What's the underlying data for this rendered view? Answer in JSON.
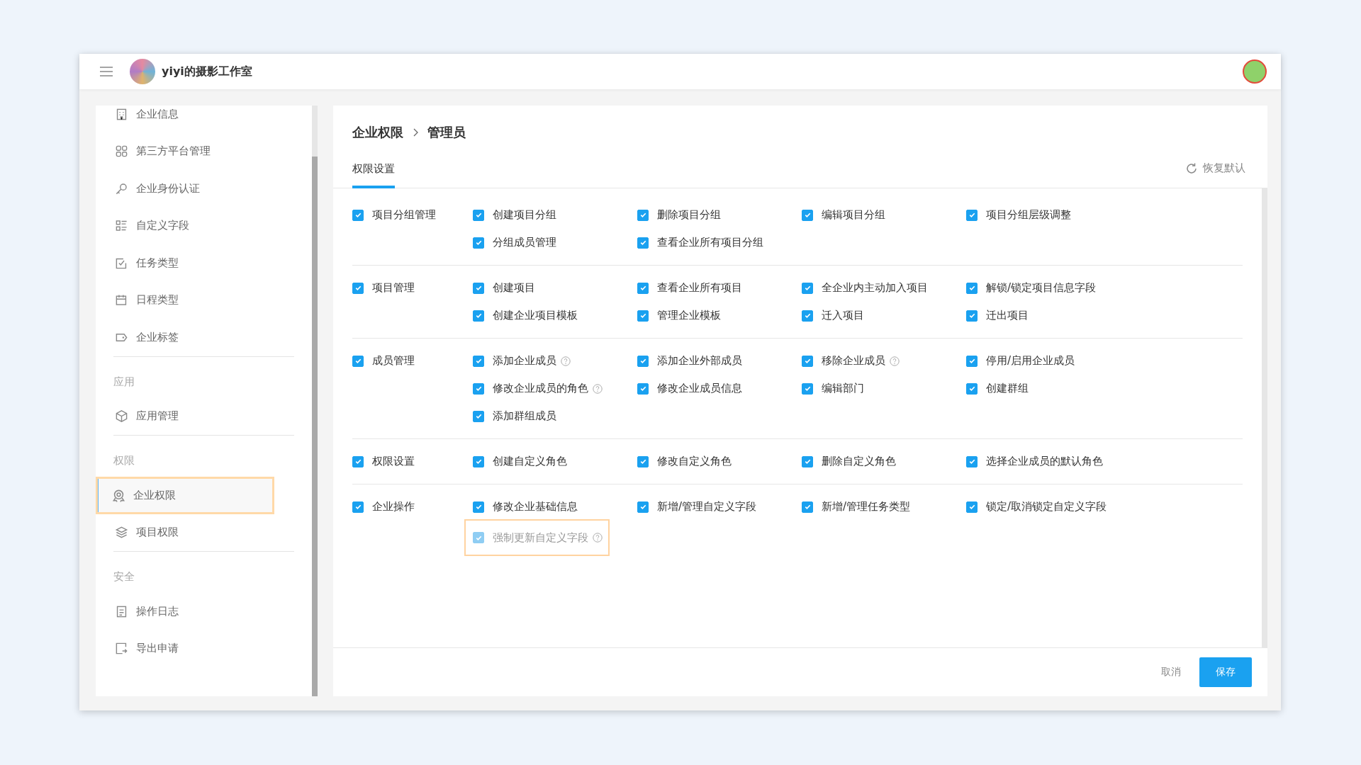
{
  "header": {
    "title": "yiyi的摄影工作室"
  },
  "sidebar": {
    "groups": [
      {
        "items": [
          {
            "label": "企业信息",
            "selected": false,
            "highlighted": false
          },
          {
            "label": "第三方平台管理",
            "selected": false,
            "highlighted": false
          },
          {
            "label": "企业身份认证",
            "selected": false,
            "highlighted": false
          },
          {
            "label": "自定义字段",
            "selected": false,
            "highlighted": false
          },
          {
            "label": "任务类型",
            "selected": false,
            "highlighted": false
          },
          {
            "label": "日程类型",
            "selected": false,
            "highlighted": false
          },
          {
            "label": "企业标签",
            "selected": false,
            "highlighted": false
          }
        ]
      },
      {
        "title": "应用",
        "items": [
          {
            "label": "应用管理",
            "selected": false,
            "highlighted": false
          }
        ]
      },
      {
        "title": "权限",
        "items": [
          {
            "label": "企业权限",
            "selected": true,
            "highlighted": true
          },
          {
            "label": "项目权限",
            "selected": false,
            "highlighted": false
          }
        ]
      },
      {
        "title": "安全",
        "items": [
          {
            "label": "操作日志",
            "selected": false,
            "highlighted": false
          },
          {
            "label": "导出申请",
            "selected": false,
            "highlighted": false
          }
        ]
      }
    ]
  },
  "breadcrumb": [
    "企业权限",
    "管理员"
  ],
  "tabs": [
    {
      "label": "权限设置",
      "selected": true
    }
  ],
  "reset_button": "恢复默认",
  "permission_groups": [
    {
      "parent": {
        "label": "项目分组管理",
        "checked": true
      },
      "children": [
        {
          "label": "创建项目分组",
          "checked": true,
          "help": false,
          "disabled": false,
          "highlighted": false
        },
        {
          "label": "删除项目分组",
          "checked": true,
          "help": false,
          "disabled": false,
          "highlighted": false
        },
        {
          "label": "编辑项目分组",
          "checked": true,
          "help": false,
          "disabled": false,
          "highlighted": false
        },
        {
          "label": "项目分组层级调整",
          "checked": true,
          "help": false,
          "disabled": false,
          "highlighted": false
        },
        {
          "label": "分组成员管理",
          "checked": true,
          "help": false,
          "disabled": false,
          "highlighted": false
        },
        {
          "label": "查看企业所有项目分组",
          "checked": true,
          "help": false,
          "disabled": false,
          "highlighted": false
        }
      ]
    },
    {
      "parent": {
        "label": "项目管理",
        "checked": true
      },
      "children": [
        {
          "label": "创建项目",
          "checked": true,
          "help": false,
          "disabled": false,
          "highlighted": false
        },
        {
          "label": "查看企业所有项目",
          "checked": true,
          "help": false,
          "disabled": false,
          "highlighted": false
        },
        {
          "label": "全企业内主动加入项目",
          "checked": true,
          "help": false,
          "disabled": false,
          "highlighted": false
        },
        {
          "label": "解锁/锁定项目信息字段",
          "checked": true,
          "help": false,
          "disabled": false,
          "highlighted": false
        },
        {
          "label": "创建企业项目模板",
          "checked": true,
          "help": false,
          "disabled": false,
          "highlighted": false
        },
        {
          "label": "管理企业模板",
          "checked": true,
          "help": false,
          "disabled": false,
          "highlighted": false
        },
        {
          "label": "迁入项目",
          "checked": true,
          "help": false,
          "disabled": false,
          "highlighted": false
        },
        {
          "label": "迁出项目",
          "checked": true,
          "help": false,
          "disabled": false,
          "highlighted": false
        }
      ]
    },
    {
      "parent": {
        "label": "成员管理",
        "checked": true
      },
      "children": [
        {
          "label": "添加企业成员",
          "checked": true,
          "help": true,
          "disabled": false,
          "highlighted": false
        },
        {
          "label": "添加企业外部成员",
          "checked": true,
          "help": false,
          "disabled": false,
          "highlighted": false
        },
        {
          "label": "移除企业成员",
          "checked": true,
          "help": true,
          "disabled": false,
          "highlighted": false
        },
        {
          "label": "停用/启用企业成员",
          "checked": true,
          "help": false,
          "disabled": false,
          "highlighted": false
        },
        {
          "label": "修改企业成员的角色",
          "checked": true,
          "help": true,
          "disabled": false,
          "highlighted": false
        },
        {
          "label": "修改企业成员信息",
          "checked": true,
          "help": false,
          "disabled": false,
          "highlighted": false
        },
        {
          "label": "编辑部门",
          "checked": true,
          "help": false,
          "disabled": false,
          "highlighted": false
        },
        {
          "label": "创建群组",
          "checked": true,
          "help": false,
          "disabled": false,
          "highlighted": false
        },
        {
          "label": "添加群组成员",
          "checked": true,
          "help": false,
          "disabled": false,
          "highlighted": false
        }
      ]
    },
    {
      "parent": {
        "label": "权限设置",
        "checked": true
      },
      "children": [
        {
          "label": "创建自定义角色",
          "checked": true,
          "help": false,
          "disabled": false,
          "highlighted": false
        },
        {
          "label": "修改自定义角色",
          "checked": true,
          "help": false,
          "disabled": false,
          "highlighted": false
        },
        {
          "label": "删除自定义角色",
          "checked": true,
          "help": false,
          "disabled": false,
          "highlighted": false
        },
        {
          "label": "选择企业成员的默认角色",
          "checked": true,
          "help": false,
          "disabled": false,
          "highlighted": false
        }
      ]
    },
    {
      "parent": {
        "label": "企业操作",
        "checked": true
      },
      "children": [
        {
          "label": "修改企业基础信息",
          "checked": true,
          "help": false,
          "disabled": false,
          "highlighted": false
        },
        {
          "label": "新增/管理自定义字段",
          "checked": true,
          "help": false,
          "disabled": false,
          "highlighted": false
        },
        {
          "label": "新增/管理任务类型",
          "checked": true,
          "help": false,
          "disabled": false,
          "highlighted": false
        },
        {
          "label": "锁定/取消锁定自定义字段",
          "checked": true,
          "help": false,
          "disabled": false,
          "highlighted": false
        },
        {
          "label": "强制更新自定义字段",
          "checked": true,
          "help": true,
          "disabled": true,
          "highlighted": true
        }
      ]
    }
  ],
  "footer": {
    "cancel": "取消",
    "save": "保存"
  }
}
